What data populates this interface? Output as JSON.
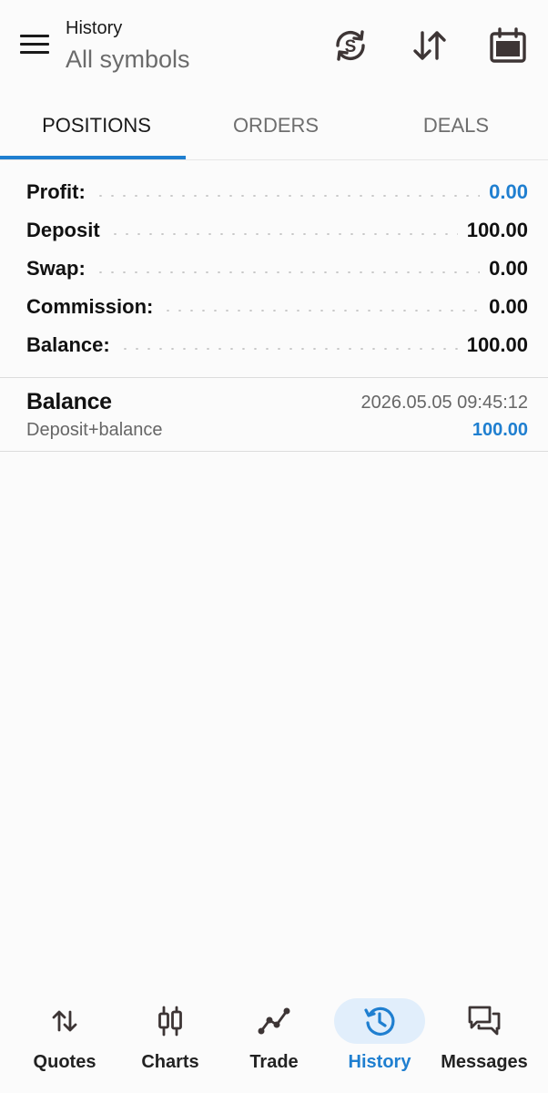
{
  "header": {
    "subtitle": "History",
    "title": "All symbols"
  },
  "tabs": [
    {
      "label": "POSITIONS",
      "active": true
    },
    {
      "label": "ORDERS",
      "active": false
    },
    {
      "label": "DEALS",
      "active": false
    }
  ],
  "summary": [
    {
      "label": "Profit:",
      "value": "0.00",
      "color": "#1f7fd0"
    },
    {
      "label": "Deposit",
      "value": "100.00",
      "color": "#111111"
    },
    {
      "label": "Swap:",
      "value": "0.00",
      "color": "#111111"
    },
    {
      "label": "Commission:",
      "value": "0.00",
      "color": "#111111"
    },
    {
      "label": "Balance:",
      "value": "100.00",
      "color": "#111111"
    }
  ],
  "deals": [
    {
      "title": "Balance",
      "time": "2026.05.05 09:45:12",
      "comment": "Deposit+balance",
      "amount": "100.00"
    }
  ],
  "nav": [
    {
      "label": "Quotes",
      "icon": "quotes-arrows-icon",
      "active": false
    },
    {
      "label": "Charts",
      "icon": "candlestick-icon",
      "active": false
    },
    {
      "label": "Trade",
      "icon": "trade-line-icon",
      "active": false
    },
    {
      "label": "History",
      "icon": "history-clock-icon",
      "active": true
    },
    {
      "label": "Messages",
      "icon": "messages-icon",
      "active": false
    }
  ],
  "colors": {
    "accent": "#1f7fd0",
    "active_pill": "#e1eefb",
    "icon_dark": "#3d3535"
  }
}
